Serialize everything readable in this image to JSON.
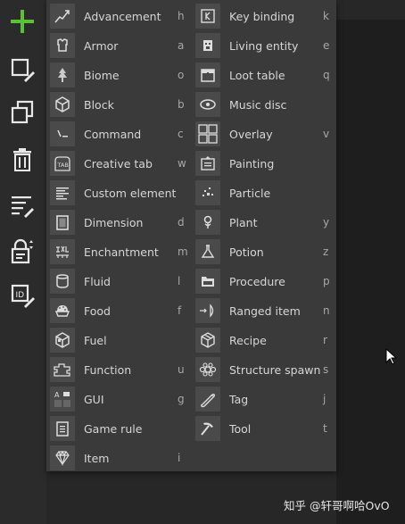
{
  "toolbar": {
    "buttons": [
      {
        "name": "add-element-button",
        "icon": "plus-icon"
      },
      {
        "name": "edit-element-button",
        "icon": "edit-icon"
      },
      {
        "name": "duplicate-element-button",
        "icon": "duplicate-icon"
      },
      {
        "name": "delete-element-button",
        "icon": "trash-icon"
      },
      {
        "name": "edit-list-button",
        "icon": "list-edit-icon"
      },
      {
        "name": "lock-element-button",
        "icon": "lock-icon"
      },
      {
        "name": "change-id-button",
        "icon": "id-edit-icon"
      }
    ]
  },
  "menu": {
    "left": [
      {
        "label": "Advancement",
        "key": "h",
        "icon": "advancement-icon"
      },
      {
        "label": "Armor",
        "key": "a",
        "icon": "armor-icon"
      },
      {
        "label": "Biome",
        "key": "o",
        "icon": "biome-icon"
      },
      {
        "label": "Block",
        "key": "b",
        "icon": "block-icon"
      },
      {
        "label": "Command",
        "key": "c",
        "icon": "command-icon"
      },
      {
        "label": "Creative tab",
        "key": "w",
        "icon": "creative-tab-icon"
      },
      {
        "label": "Custom element",
        "key": "",
        "icon": "custom-element-icon"
      },
      {
        "label": "Dimension",
        "key": "d",
        "icon": "dimension-icon"
      },
      {
        "label": "Enchantment",
        "key": "m",
        "icon": "enchantment-icon"
      },
      {
        "label": "Fluid",
        "key": "l",
        "icon": "fluid-icon"
      },
      {
        "label": "Food",
        "key": "f",
        "icon": "food-icon"
      },
      {
        "label": "Fuel",
        "key": "",
        "icon": "fuel-icon"
      },
      {
        "label": "Function",
        "key": "u",
        "icon": "function-icon"
      },
      {
        "label": "GUI",
        "key": "g",
        "icon": "gui-icon"
      },
      {
        "label": "Game rule",
        "key": "",
        "icon": "game-rule-icon"
      },
      {
        "label": "Item",
        "key": "i",
        "icon": "item-icon"
      }
    ],
    "right": [
      {
        "label": "Key binding",
        "key": "k",
        "icon": "key-binding-icon"
      },
      {
        "label": "Living entity",
        "key": "e",
        "icon": "living-entity-icon"
      },
      {
        "label": "Loot table",
        "key": "q",
        "icon": "loot-table-icon"
      },
      {
        "label": "Music disc",
        "key": "",
        "icon": "music-disc-icon"
      },
      {
        "label": "Overlay",
        "key": "v",
        "icon": "overlay-icon"
      },
      {
        "label": "Painting",
        "key": "",
        "icon": "painting-icon"
      },
      {
        "label": "Particle",
        "key": "",
        "icon": "particle-icon"
      },
      {
        "label": "Plant",
        "key": "y",
        "icon": "plant-icon"
      },
      {
        "label": "Potion",
        "key": "z",
        "icon": "potion-icon"
      },
      {
        "label": "Procedure",
        "key": "p",
        "icon": "procedure-icon"
      },
      {
        "label": "Ranged item",
        "key": "n",
        "icon": "ranged-item-icon"
      },
      {
        "label": "Recipe",
        "key": "r",
        "icon": "recipe-icon"
      },
      {
        "label": "Structure spawn",
        "key": "s",
        "icon": "structure-spawn-icon"
      },
      {
        "label": "Tag",
        "key": "j",
        "icon": "tag-icon"
      },
      {
        "label": "Tool",
        "key": "t",
        "icon": "tool-icon"
      }
    ]
  },
  "watermark": "知乎 @轩哥啊哈OvO",
  "colors": {
    "accent_green": "#5bc236",
    "menu_bg": "#3a3a3a",
    "icon_bg": "#4a4a4a",
    "text": "#d6d6d6"
  }
}
